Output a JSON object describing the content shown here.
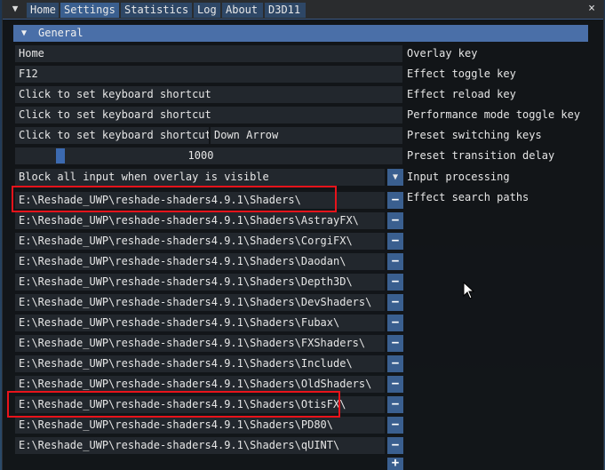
{
  "tabs": [
    {
      "label": "Home"
    },
    {
      "label": "Settings"
    },
    {
      "label": "Statistics"
    },
    {
      "label": "Log"
    },
    {
      "label": "About"
    },
    {
      "label": "D3D11"
    }
  ],
  "active_tab": "Settings",
  "menu_toggle_icon": "▼",
  "close_icon": "×",
  "section": {
    "arrow": "▼",
    "title": "General"
  },
  "settings": {
    "overlay_key": {
      "value": "Home",
      "label": "Overlay key"
    },
    "effect_toggle_key": {
      "value": "F12",
      "label": "Effect toggle key"
    },
    "effect_reload_key": {
      "value": "Click to set keyboard shortcut",
      "label": "Effect reload key"
    },
    "performance_mode_key": {
      "value": "Click to set keyboard shortcut",
      "label": "Performance mode toggle key"
    },
    "preset_switching_keys": {
      "value_prev": "Click to set keyboard shortcut",
      "value_next": "Down Arrow",
      "label": "Preset switching keys"
    },
    "preset_transition_delay": {
      "value": "1000",
      "fraction": 0.11,
      "label": "Preset transition delay"
    },
    "input_processing": {
      "value": "Block all input when overlay is visible",
      "label": "Input processing",
      "combo_icon": "▼"
    },
    "effect_search_paths": {
      "label": "Effect search paths",
      "minus_symbol": "−",
      "plus_symbol": "+",
      "paths": [
        "E:\\Reshade_UWP\\reshade-shaders4.9.1\\Shaders\\",
        "E:\\Reshade_UWP\\reshade-shaders4.9.1\\Shaders\\AstrayFX\\",
        "E:\\Reshade_UWP\\reshade-shaders4.9.1\\Shaders\\CorgiFX\\",
        "E:\\Reshade_UWP\\reshade-shaders4.9.1\\Shaders\\Daodan\\",
        "E:\\Reshade_UWP\\reshade-shaders4.9.1\\Shaders\\Depth3D\\",
        "E:\\Reshade_UWP\\reshade-shaders4.9.1\\Shaders\\DevShaders\\",
        "E:\\Reshade_UWP\\reshade-shaders4.9.1\\Shaders\\Fubax\\",
        "E:\\Reshade_UWP\\reshade-shaders4.9.1\\Shaders\\FXShaders\\",
        "E:\\Reshade_UWP\\reshade-shaders4.9.1\\Shaders\\Include\\",
        "E:\\Reshade_UWP\\reshade-shaders4.9.1\\Shaders\\OldShaders\\",
        "E:\\Reshade_UWP\\reshade-shaders4.9.1\\Shaders\\OtisFX\\",
        "E:\\Reshade_UWP\\reshade-shaders4.9.1\\Shaders\\PD80\\",
        "E:\\Reshade_UWP\\reshade-shaders4.9.1\\Shaders\\qUINT\\"
      ]
    }
  },
  "colors": {
    "accent": "#3a5f8f",
    "section_header": "#4a6fa8",
    "annotation_box": "#e8131b"
  }
}
